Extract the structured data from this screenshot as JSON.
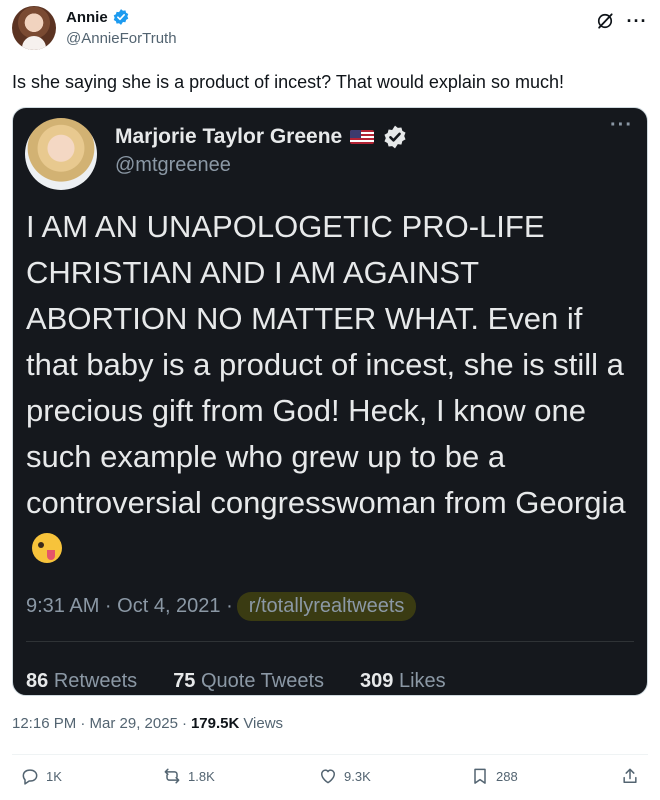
{
  "post": {
    "author_name": "Annie",
    "author_handle": "@AnnieForTruth",
    "text": "Is she saying she is a product of incest? That would explain so much!",
    "timestamp": "12:16 PM · Mar 29, 2025",
    "views_count": "179.5K",
    "views_label": "Views"
  },
  "embedded": {
    "name": "Marjorie Taylor Greene",
    "handle": "@mtgreenee",
    "text": "I AM AN UNAPOLOGETIC PRO-LIFE CHRISTIAN AND I AM AGAINST ABORTION NO MATTER WHAT. Even if that baby is a product of incest, she is still a precious gift from God! Heck, I know one such example who grew up to be a controversial congresswoman from Georgia",
    "timestamp": "9:31 AM · Oct 4, 2021 ·",
    "source": "r/totallyrealtweets",
    "retweets_count": "86",
    "retweets_label": "Retweets",
    "quotes_count": "75",
    "quotes_label": "Quote Tweets",
    "likes_count": "309",
    "likes_label": "Likes"
  },
  "actions": {
    "replies": "1K",
    "reposts": "1.8K",
    "likes": "9.3K",
    "bookmarks": "288"
  },
  "icons": {
    "verified": "verified-badge-icon",
    "grok": "grok-icon",
    "more": "more-icon",
    "reply": "reply-icon",
    "repost": "repost-icon",
    "like": "heart-icon",
    "bookmark": "bookmark-icon",
    "share": "share-icon",
    "emoji": "winking-tongue-emoji",
    "flag": "us-flag-icon"
  },
  "colors": {
    "verified_blue": "#1d9bf0",
    "text_primary": "#0f1419",
    "text_secondary": "#536471",
    "embedded_bg": "#15181d"
  }
}
